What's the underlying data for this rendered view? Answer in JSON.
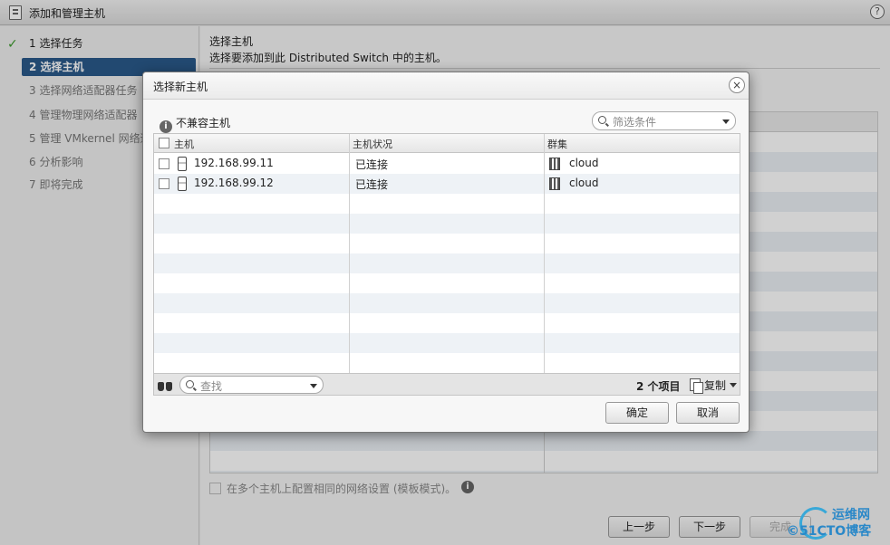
{
  "window": {
    "title": "添加和管理主机",
    "help": "?"
  },
  "steps": [
    {
      "label": "1  选择任务",
      "state": "done"
    },
    {
      "label": "2  选择主机",
      "state": "active"
    },
    {
      "label": "3  选择网络适配器任务",
      "state": "pending"
    },
    {
      "label": "4  管理物理网络适配器",
      "state": "pending"
    },
    {
      "label": "5  管理 VMkernel 网络适配器",
      "state": "pending"
    },
    {
      "label": "6  分析影响",
      "state": "pending"
    },
    {
      "label": "7  即将完成",
      "state": "pending"
    }
  ],
  "header": {
    "title": "选择主机",
    "description": "选择要添加到此 Distributed Switch 中的主机。"
  },
  "template_mode": {
    "label": "在多个主机上配置相同的网络设置 (模板模式)。",
    "info": "i"
  },
  "footer": {
    "back": "上一步",
    "next": "下一步",
    "finish": "完成"
  },
  "dialog": {
    "title": "选择新主机",
    "close": "×",
    "incompatible": "不兼容主机",
    "info": "i",
    "filter_placeholder": "筛选条件",
    "columns": [
      "主机",
      "主机状况",
      "群集"
    ],
    "rows": [
      {
        "host": "192.168.99.11",
        "status": "已连接",
        "cluster": "cloud"
      },
      {
        "host": "192.168.99.12",
        "status": "已连接",
        "cluster": "cloud"
      }
    ],
    "search_placeholder": "查找",
    "count": "2 个项目",
    "copy": "复制",
    "ok": "确定",
    "cancel": "取消"
  },
  "watermark": {
    "top": "运维网",
    "bottom": "©51CTO博客"
  },
  "colors": {
    "accent": "#2a5a8a",
    "check": "#3a9a2a",
    "watermark": "#2a88c8"
  }
}
